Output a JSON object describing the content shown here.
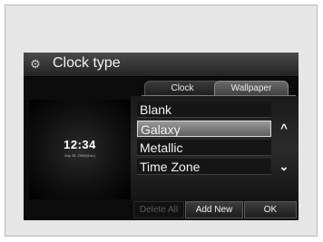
{
  "header": {
    "title": "Clock type",
    "settings_icon": "gear-icon"
  },
  "tabs": [
    {
      "label": "Clock",
      "active": false
    },
    {
      "label": "Wallpaper",
      "active": true
    }
  ],
  "preview": {
    "time": "12:34",
    "date": "July 28, 2008(Sun.)"
  },
  "list": {
    "items": [
      "Blank",
      "Galaxy",
      "Metallic",
      "Time Zone"
    ],
    "selected": "Galaxy"
  },
  "scroll": {
    "up_icon": "chevron-up-icon",
    "down_icon": "chevron-down-icon"
  },
  "buttons": {
    "delete_all": "Delete All",
    "add_new": "Add New",
    "ok": "OK"
  }
}
